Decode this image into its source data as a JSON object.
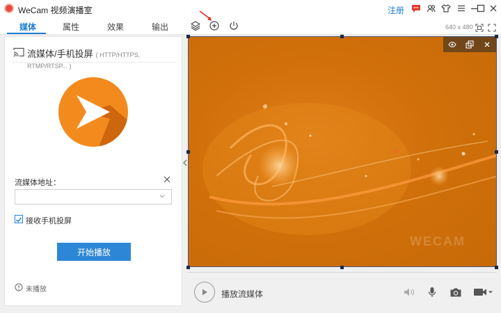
{
  "app": {
    "title": "WeCam 视频演播室"
  },
  "header": {
    "register": "注册"
  },
  "tabs": [
    {
      "label": "媒体",
      "active": true
    },
    {
      "label": "属性",
      "active": false
    },
    {
      "label": "效果",
      "active": false
    },
    {
      "label": "输出",
      "active": false
    }
  ],
  "preview": {
    "resolution": "640 x 480",
    "watermark": "WECAM"
  },
  "left_panel": {
    "title": "流媒体/手机投屏",
    "title_sub": "( HTTP/HTTPS, RTMP/RTSP... )",
    "url_label": "流媒体地址：",
    "url_value": "",
    "receive_label": "接收手机投屏",
    "receive_checked": true,
    "start_button": "开始播放",
    "status": "未播放"
  },
  "controls": {
    "play_label": "播放流媒体"
  },
  "colors": {
    "accent": "#1f7fd6",
    "button": "#2d86d6",
    "preview_bg": "#d1700a"
  }
}
